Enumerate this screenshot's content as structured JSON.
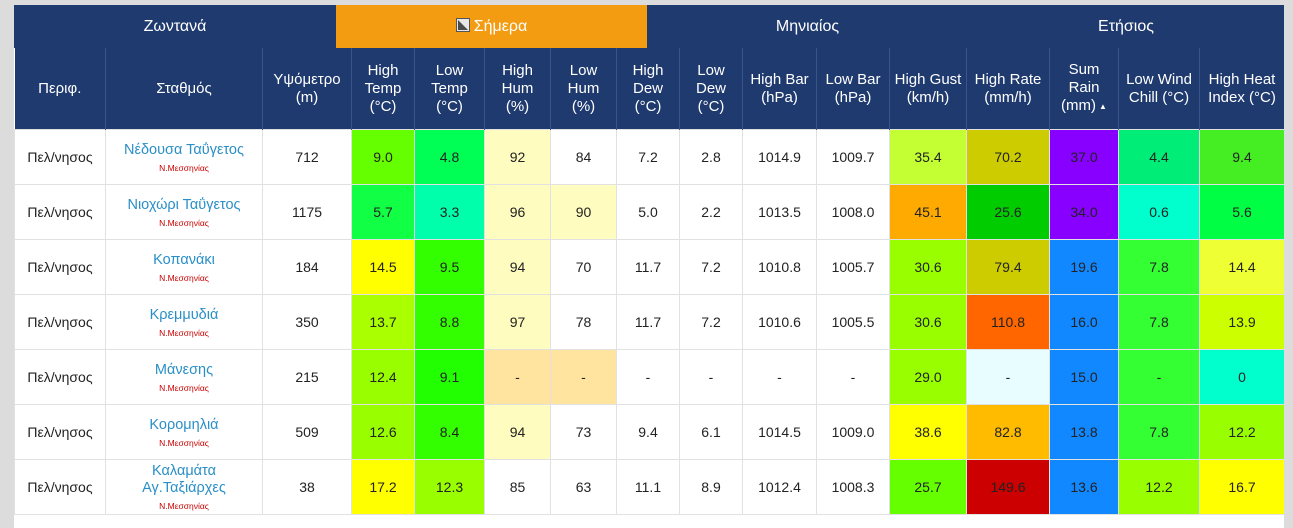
{
  "tabs": [
    {
      "label": "Ζωντανά",
      "active": false
    },
    {
      "label": "Σήμερα",
      "active": true
    },
    {
      "label": "Μηνιαίος",
      "active": false
    },
    {
      "label": "Ετήσιος",
      "active": false
    }
  ],
  "columns": [
    "Περιφ.",
    "Σταθμός",
    "Υψόμετρο\n(m)",
    "High\nTemp\n(°C)",
    "Low\nTemp\n(°C)",
    "High\nHum\n(%)",
    "Low\nHum\n(%)",
    "High\nDew\n(°C)",
    "Low\nDew\n(°C)",
    "High Bar\n(hPa)",
    "Low Bar\n(hPa)",
    "High Gust\n(km/h)",
    "High Rate\n(mm/h)",
    "Sum\nRain\n(mm)",
    "Low Wind\nChill (°C)",
    "High Heat\nIndex (°C)"
  ],
  "sort_indicator": "▲",
  "rows": [
    {
      "region": "Πελ/νησος",
      "name": "Νέδουσα Ταΰγετος",
      "sub": "Ν.Μεσσηνίας",
      "alt": "712",
      "cells": [
        [
          "9.0",
          "#66ff00"
        ],
        [
          "4.8",
          "#00ff55"
        ],
        [
          "92",
          "#fffcbf"
        ],
        [
          "84",
          "#ffffff"
        ],
        [
          "7.2",
          "#ffffff"
        ],
        [
          "2.8",
          "#ffffff"
        ],
        [
          "1014.9",
          "#ffffff"
        ],
        [
          "1009.7",
          "#ffffff"
        ],
        [
          "35.4",
          "#c4ff33"
        ],
        [
          "70.2",
          "#cccc00"
        ],
        [
          "37.0",
          "#8800ff"
        ],
        [
          "4.4",
          "#00ee77"
        ],
        [
          "9.4",
          "#44ee22"
        ]
      ]
    },
    {
      "region": "Πελ/νησος",
      "name": "Νιοχώρι Ταΰγετος",
      "sub": "Ν.Μεσσηνίας",
      "alt": "1175",
      "cells": [
        [
          "5.7",
          "#11ff44"
        ],
        [
          "3.3",
          "#00ffaa"
        ],
        [
          "96",
          "#fffcbf"
        ],
        [
          "90",
          "#fffcbf"
        ],
        [
          "5.0",
          "#ffffff"
        ],
        [
          "2.2",
          "#ffffff"
        ],
        [
          "1013.5",
          "#ffffff"
        ],
        [
          "1008.0",
          "#ffffff"
        ],
        [
          "45.1",
          "#ffaa00"
        ],
        [
          "25.6",
          "#00cc00"
        ],
        [
          "34.0",
          "#8800ff"
        ],
        [
          "0.6",
          "#00ffcc"
        ],
        [
          "5.6",
          "#00ff44"
        ]
      ]
    },
    {
      "region": "Πελ/νησος",
      "name": "Κοπανάκι",
      "sub": "Ν.Μεσσηνίας",
      "alt": "184",
      "cells": [
        [
          "14.5",
          "#ffff00"
        ],
        [
          "9.5",
          "#33ff00"
        ],
        [
          "94",
          "#fffcbf"
        ],
        [
          "70",
          "#ffffff"
        ],
        [
          "11.7",
          "#ffffff"
        ],
        [
          "7.2",
          "#ffffff"
        ],
        [
          "1010.8",
          "#ffffff"
        ],
        [
          "1005.7",
          "#ffffff"
        ],
        [
          "30.6",
          "#99ff00"
        ],
        [
          "79.4",
          "#cccc00"
        ],
        [
          "19.6",
          "#1188ff"
        ],
        [
          "7.8",
          "#33ff33"
        ],
        [
          "14.4",
          "#eeff33"
        ]
      ]
    },
    {
      "region": "Πελ/νησος",
      "name": "Κρεμμυδιά",
      "sub": "Ν.Μεσσηνίας",
      "alt": "350",
      "cells": [
        [
          "13.7",
          "#aaff00"
        ],
        [
          "8.8",
          "#33ff00"
        ],
        [
          "97",
          "#fffcbf"
        ],
        [
          "78",
          "#ffffff"
        ],
        [
          "11.7",
          "#ffffff"
        ],
        [
          "7.2",
          "#ffffff"
        ],
        [
          "1010.6",
          "#ffffff"
        ],
        [
          "1005.5",
          "#ffffff"
        ],
        [
          "30.6",
          "#99ff00"
        ],
        [
          "110.8",
          "#ff6600"
        ],
        [
          "16.0",
          "#1188ff"
        ],
        [
          "7.8",
          "#33ff33"
        ],
        [
          "13.9",
          "#ccff00"
        ]
      ]
    },
    {
      "region": "Πελ/νησος",
      "name": "Μάνεσης",
      "sub": "Ν.Μεσσηνίας",
      "alt": "215",
      "cells": [
        [
          "12.4",
          "#99ff00"
        ],
        [
          "9.1",
          "#22ff00"
        ],
        [
          "-",
          "#ffe4a0"
        ],
        [
          "-",
          "#ffe4a0"
        ],
        [
          "-",
          "#ffffff"
        ],
        [
          "-",
          "#ffffff"
        ],
        [
          "-",
          "#ffffff"
        ],
        [
          "-",
          "#ffffff"
        ],
        [
          "29.0",
          "#99ff00"
        ],
        [
          "-",
          "#e8fdff"
        ],
        [
          "15.0",
          "#1188ff"
        ],
        [
          "-",
          "#33ff33"
        ],
        [
          "0",
          "#00ffcc"
        ]
      ]
    },
    {
      "region": "Πελ/νησος",
      "name": "Κορομηλιά",
      "sub": "Ν.Μεσσηνίας",
      "alt": "509",
      "cells": [
        [
          "12.6",
          "#99ff00"
        ],
        [
          "8.4",
          "#33ff00"
        ],
        [
          "94",
          "#fffcbf"
        ],
        [
          "73",
          "#ffffff"
        ],
        [
          "9.4",
          "#ffffff"
        ],
        [
          "6.1",
          "#ffffff"
        ],
        [
          "1014.5",
          "#ffffff"
        ],
        [
          "1009.0",
          "#ffffff"
        ],
        [
          "38.6",
          "#ffff00"
        ],
        [
          "82.8",
          "#ffbb00"
        ],
        [
          "13.8",
          "#1188ff"
        ],
        [
          "7.8",
          "#33ff33"
        ],
        [
          "12.2",
          "#99ff00"
        ]
      ]
    },
    {
      "region": "Πελ/νησος",
      "name": "Καλαμάτα\nΑγ.Ταξιάρχες",
      "sub": "Ν.Μεσσηνίας",
      "alt": "38",
      "cells": [
        [
          "17.2",
          "#ffff00"
        ],
        [
          "12.3",
          "#99ff00"
        ],
        [
          "85",
          "#ffffff"
        ],
        [
          "63",
          "#ffffff"
        ],
        [
          "11.1",
          "#ffffff"
        ],
        [
          "8.9",
          "#ffffff"
        ],
        [
          "1012.4",
          "#ffffff"
        ],
        [
          "1008.3",
          "#ffffff"
        ],
        [
          "25.7",
          "#66ff00"
        ],
        [
          "149.6",
          "#cc0000"
        ],
        [
          "13.6",
          "#1188ff"
        ],
        [
          "12.2",
          "#99ff00"
        ],
        [
          "16.7",
          "#ffff00"
        ]
      ]
    }
  ]
}
